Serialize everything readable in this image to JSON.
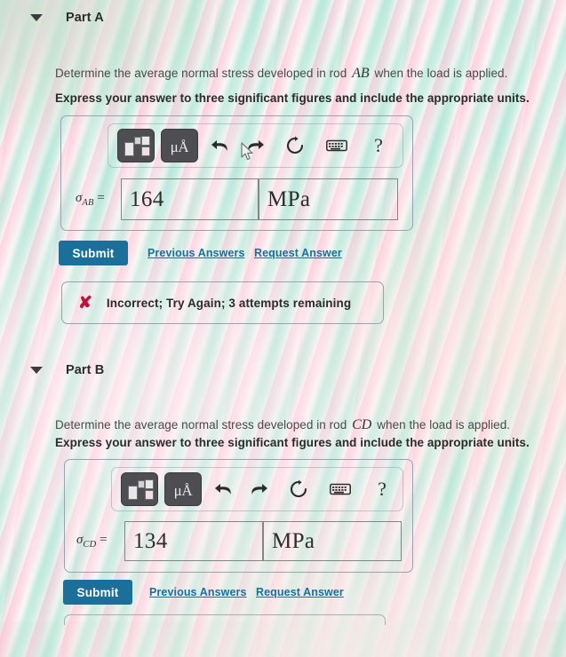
{
  "page": {
    "background_pink": "#ffcdde",
    "background_mint": "#b0e9d9",
    "accent_blue": "#1b6f99",
    "error_red": "#c1123a"
  },
  "parts": [
    {
      "id": "part-a",
      "title": "Part A",
      "chevron_icon": "chevron-down-icon",
      "prompt_before": "Determine the average normal stress developed in rod ",
      "prompt_math": "AB",
      "prompt_after": " when the load is applied.",
      "instruction": "Express your answer to three significant figures and include the appropriate units.",
      "toolbar": {
        "template_label": "math-template-icon",
        "units_label": "μÅ",
        "undo_label": "undo-icon",
        "redo_label": "redo-icon",
        "reset_label": "reset-icon",
        "keyboard_label": "keyboard-icon",
        "help_label": "?"
      },
      "answer": {
        "symbol": "σ",
        "subscript": "AB",
        "equals": "=",
        "value": "164",
        "units": "MPa",
        "placeholder": ""
      },
      "actions": {
        "submit_label": "Submit",
        "previous_answers_label": "Previous Answers",
        "request_answer_label": "Request Answer"
      },
      "feedback": {
        "icon": "x-mark-icon",
        "text": "Incorrect; Try Again; 3 attempts remaining"
      }
    },
    {
      "id": "part-b",
      "title": "Part B",
      "chevron_icon": "chevron-down-icon",
      "prompt_before": "Determine the average normal stress developed in rod ",
      "prompt_math": "CD",
      "prompt_after": " when the load is applied.",
      "instruction": "Express your answer to three significant figures and include the appropriate units.",
      "toolbar": {
        "template_label": "math-template-icon",
        "units_label": "μÅ",
        "undo_label": "undo-icon",
        "redo_label": "redo-icon",
        "reset_label": "reset-icon",
        "keyboard_label": "keyboard-icon",
        "help_label": "?"
      },
      "answer": {
        "symbol": "σ",
        "subscript": "CD",
        "equals": "=",
        "value": "134",
        "units": "MPa",
        "placeholder": ""
      },
      "actions": {
        "submit_label": "Submit",
        "previous_answers_label": "Previous Answers",
        "request_answer_label": "Request Answer"
      }
    }
  ]
}
